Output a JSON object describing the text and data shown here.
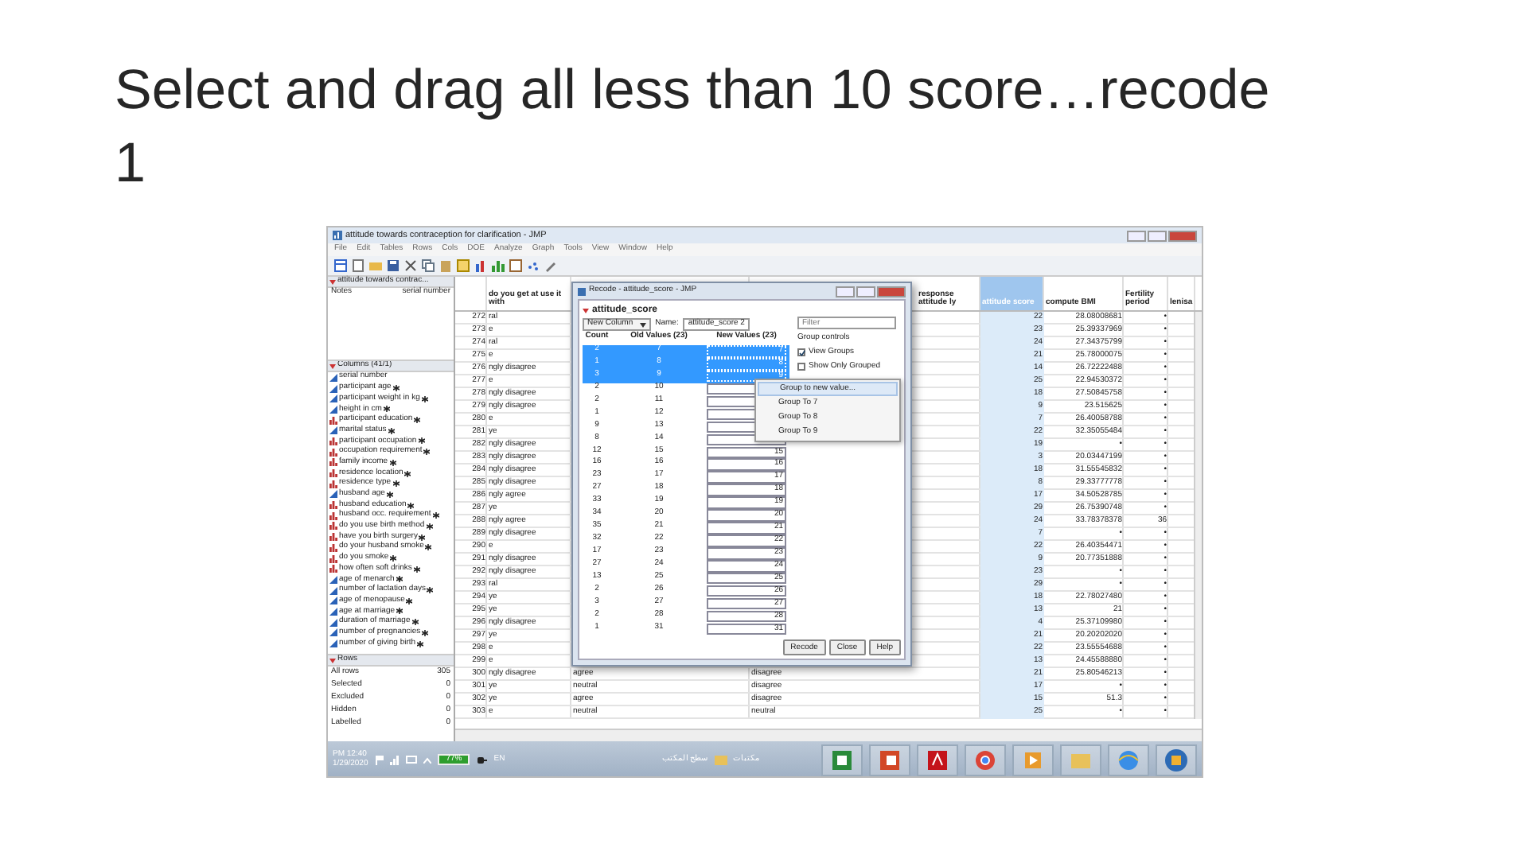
{
  "slide": {
    "title": "Select and drag all less than 10 score…recode 1"
  },
  "window": {
    "title": "attitude towards contraception for clarification - JMP",
    "menu": [
      "File",
      "Edit",
      "Tables",
      "Rows",
      "Cols",
      "DOE",
      "Analyze",
      "Graph",
      "Tools",
      "View",
      "Window",
      "Help"
    ]
  },
  "table_panel": {
    "name": "attitude towards contrac...",
    "notes_label": "Notes",
    "notes_value": "serial number"
  },
  "columns_panel": {
    "title": "Columns (41/1)",
    "items": [
      {
        "name": "serial number",
        "kind": "continuous",
        "flagged": false
      },
      {
        "name": "participant age",
        "kind": "continuous",
        "flagged": true
      },
      {
        "name": "participant weight in kg",
        "kind": "continuous",
        "flagged": true
      },
      {
        "name": "height in cm",
        "kind": "continuous",
        "flagged": true
      },
      {
        "name": "participant education",
        "kind": "nominal",
        "flagged": true
      },
      {
        "name": "marital status",
        "kind": "continuous",
        "flagged": true
      },
      {
        "name": "participant occupation",
        "kind": "nominal",
        "flagged": true
      },
      {
        "name": "occupation requirement",
        "kind": "nominal",
        "flagged": true
      },
      {
        "name": "family income",
        "kind": "nominal",
        "flagged": true
      },
      {
        "name": "residence location",
        "kind": "nominal",
        "flagged": true
      },
      {
        "name": "residence type",
        "kind": "nominal",
        "flagged": true
      },
      {
        "name": "husband age",
        "kind": "continuous",
        "flagged": true
      },
      {
        "name": "husband education",
        "kind": "nominal",
        "flagged": true
      },
      {
        "name": "husband occ. requirement",
        "kind": "nominal",
        "flagged": true
      },
      {
        "name": "do you use birth method",
        "kind": "nominal",
        "flagged": true
      },
      {
        "name": "have you birth surgery",
        "kind": "nominal",
        "flagged": true
      },
      {
        "name": "do your husband smoke",
        "kind": "nominal",
        "flagged": true
      },
      {
        "name": "do you smoke",
        "kind": "nominal",
        "flagged": true
      },
      {
        "name": "how often soft drinks",
        "kind": "nominal",
        "flagged": true
      },
      {
        "name": "age of menarch",
        "kind": "continuous",
        "flagged": true
      },
      {
        "name": "number of lactation days",
        "kind": "continuous",
        "flagged": true
      },
      {
        "name": "age of menopause",
        "kind": "continuous",
        "flagged": true
      },
      {
        "name": "age at marriage",
        "kind": "continuous",
        "flagged": true
      },
      {
        "name": "duration of marriage",
        "kind": "continuous",
        "flagged": true
      },
      {
        "name": "number of pregnancies",
        "kind": "continuous",
        "flagged": true
      },
      {
        "name": "number of giving birth",
        "kind": "continuous",
        "flagged": true
      }
    ]
  },
  "rows_panel": {
    "title": "Rows",
    "items": [
      {
        "label": "All rows",
        "value": "305"
      },
      {
        "label": "Selected",
        "value": "0"
      },
      {
        "label": "Excluded",
        "value": "0"
      },
      {
        "label": "Hidden",
        "value": "0"
      },
      {
        "label": "Labelled",
        "value": "0"
      }
    ]
  },
  "grid": {
    "columns": [
      {
        "label": "do you get at use it with",
        "selected": false
      },
      {
        "label": "response attitude ly",
        "selected": false
      },
      {
        "label": "attitude score",
        "selected": true
      },
      {
        "label": "compute BMI",
        "selected": false
      },
      {
        "label": "Fertility period",
        "selected": false
      },
      {
        "label": "lenisa",
        "selected": false
      }
    ],
    "rows": [
      {
        "n": "272",
        "column_2": "ral",
        "score": "22",
        "bmi": "28.08008681",
        "fertility": "•"
      },
      {
        "n": "273",
        "column_2": "e",
        "score": "23",
        "bmi": "25.39337969",
        "fertility": "•"
      },
      {
        "n": "274",
        "column_2": "ral",
        "score": "24",
        "bmi": "27.34375799",
        "fertility": "•"
      },
      {
        "n": "275",
        "column_2": "e",
        "score": "21",
        "bmi": "25.78000075",
        "fertility": "•"
      },
      {
        "n": "276",
        "column_2": "ngly disagree",
        "score": "14",
        "bmi": "26.72222488",
        "fertility": "•"
      },
      {
        "n": "277",
        "column_2": "e",
        "score": "25",
        "bmi": "22.94530372",
        "fertility": "•"
      },
      {
        "n": "278",
        "column_2": "ngly disagree",
        "score": "18",
        "bmi": "27.50845758",
        "fertility": "•"
      },
      {
        "n": "279",
        "column_2": "ngly disagree",
        "score": "9",
        "bmi": "23.515625",
        "fertility": "•"
      },
      {
        "n": "280",
        "column_2": "e",
        "score": "7",
        "bmi": "26.40058788",
        "fertility": "•"
      },
      {
        "n": "281",
        "column_2": "ye",
        "score": "22",
        "bmi": "32.35055484",
        "fertility": "•"
      },
      {
        "n": "282",
        "column_2": "ngly disagree",
        "score": "19",
        "bmi": "•",
        "fertility": "•"
      },
      {
        "n": "283",
        "column_2": "ngly disagree",
        "score": "3",
        "bmi": "20.03447199",
        "fertility": "•"
      },
      {
        "n": "284",
        "column_2": "ngly disagree",
        "score": "18",
        "bmi": "31.55545832",
        "fertility": "•"
      },
      {
        "n": "285",
        "column_2": "ngly disagree",
        "score": "8",
        "bmi": "29.33777778",
        "fertility": "•"
      },
      {
        "n": "286",
        "column_2": "ngly agree",
        "score": "17",
        "bmi": "34.50528785",
        "fertility": "•"
      },
      {
        "n": "287",
        "column_2": "ye",
        "score": "29",
        "bmi": "26.75390748",
        "fertility": "•"
      },
      {
        "n": "288",
        "column_2": "ngly agree",
        "score": "24",
        "bmi": "33.78378378",
        "fertility": "36"
      },
      {
        "n": "289",
        "column_2": "ngly disagree",
        "score": "7",
        "bmi": "•",
        "fertility": "•"
      },
      {
        "n": "290",
        "column_2": "e",
        "score": "22",
        "bmi": "26.40354471",
        "fertility": "•"
      },
      {
        "n": "291",
        "column_2": "ngly disagree",
        "score": "9",
        "bmi": "20.77351888",
        "fertility": "•"
      },
      {
        "n": "292",
        "column_2": "ngly disagree",
        "score": "23",
        "bmi": "•",
        "fertility": "•"
      },
      {
        "n": "293",
        "column_2": "ral",
        "score": "29",
        "bmi": "•",
        "fertility": "•"
      },
      {
        "n": "294",
        "column_2": "ye",
        "score": "18",
        "bmi": "22.78027480",
        "fertility": "•"
      },
      {
        "n": "295",
        "column_2": "ye",
        "score": "13",
        "bmi": "21",
        "fertility": "•"
      },
      {
        "n": "296",
        "column_2": "ngly disagree",
        "score": "4",
        "bmi": "25.37109980",
        "fertility": "•"
      },
      {
        "n": "297",
        "column_2": "ye",
        "score": "21",
        "bmi": "20.20202020",
        "fertility": "•"
      },
      {
        "n": "298",
        "column_2": "e",
        "score": "22",
        "bmi": "23.55554688",
        "fertility": "•"
      },
      {
        "n": "299",
        "column_2": "e",
        "score": "13",
        "bmi": "24.45588880",
        "fertility": "•"
      },
      {
        "n": "300",
        "column_2": "ngly disagree",
        "column_3": "agree",
        "column_4": "disagree",
        "score": "21",
        "bmi": "25.80546213",
        "fertility": "•"
      },
      {
        "n": "301",
        "column_2": "ye",
        "column_3": "neutral",
        "column_4": "disagree",
        "score": "17",
        "bmi": "•",
        "fertility": "•"
      },
      {
        "n": "302",
        "column_2": "ye",
        "column_3": "agree",
        "column_4": "disagree",
        "score": "15",
        "bmi": "51.3",
        "fertility": "•"
      },
      {
        "n": "303",
        "column_2": "e",
        "column_3": "neutral",
        "column_4": "neutral",
        "score": "25",
        "bmi": "•",
        "fertility": "•"
      }
    ]
  },
  "dialog": {
    "title": "Recode - attitude_score - JMP",
    "heading": "attitude_score",
    "mode": "New Column",
    "name_label": "Name:",
    "name_value": "attitude_score 2",
    "filter_placeholder": "Filter",
    "group_controls": "Group controls",
    "options": [
      {
        "label": "View Groups",
        "checked": true
      },
      {
        "label": "Show Only Grouped",
        "checked": false
      }
    ],
    "columns": [
      "Count",
      "Old Values (23)",
      "New Values (23)"
    ],
    "rows": [
      {
        "count": "2",
        "old": "7",
        "new": "7",
        "selected": true
      },
      {
        "count": "1",
        "old": "8",
        "new": "8",
        "selected": true
      },
      {
        "count": "3",
        "old": "9",
        "new": "9",
        "selected": true
      },
      {
        "count": "2",
        "old": "10",
        "selected": false
      },
      {
        "count": "2",
        "old": "11",
        "selected": false
      },
      {
        "count": "1",
        "old": "12",
        "selected": false
      },
      {
        "count": "9",
        "old": "13",
        "selected": false
      },
      {
        "count": "8",
        "old": "14",
        "selected": false
      },
      {
        "count": "12",
        "old": "15",
        "new": "15",
        "selected": false
      },
      {
        "count": "16",
        "old": "16",
        "new": "16",
        "selected": false
      },
      {
        "count": "23",
        "old": "17",
        "new": "17",
        "selected": false
      },
      {
        "count": "27",
        "old": "18",
        "new": "18",
        "selected": false
      },
      {
        "count": "33",
        "old": "19",
        "new": "19",
        "selected": false
      },
      {
        "count": "34",
        "old": "20",
        "new": "20",
        "selected": false
      },
      {
        "count": "35",
        "old": "21",
        "new": "21",
        "selected": false
      },
      {
        "count": "32",
        "old": "22",
        "new": "22",
        "selected": false
      },
      {
        "count": "17",
        "old": "23",
        "new": "23",
        "selected": false
      },
      {
        "count": "27",
        "old": "24",
        "new": "24",
        "selected": false
      },
      {
        "count": "13",
        "old": "25",
        "new": "25",
        "selected": false
      },
      {
        "count": "2",
        "old": "26",
        "new": "26",
        "selected": false
      },
      {
        "count": "3",
        "old": "27",
        "new": "27",
        "selected": false
      },
      {
        "count": "2",
        "old": "28",
        "new": "28",
        "selected": false
      },
      {
        "count": "1",
        "old": "31",
        "new": "31",
        "selected": false
      }
    ],
    "buttons": [
      "Recode",
      "Close",
      "Help"
    ]
  },
  "context_menu": {
    "items": [
      {
        "label": "Group to new value...",
        "selected": true
      },
      {
        "label": "Group To 7",
        "selected": false
      },
      {
        "label": "Group To 8",
        "selected": false
      },
      {
        "label": "Group To 9",
        "selected": false
      }
    ]
  },
  "taskbar": {
    "time": "PM 12:40",
    "date": "1/29/2020",
    "battery": "77%",
    "language": "EN",
    "toolbar_labels": [
      "مكتبات",
      "سطح المكتب"
    ]
  }
}
